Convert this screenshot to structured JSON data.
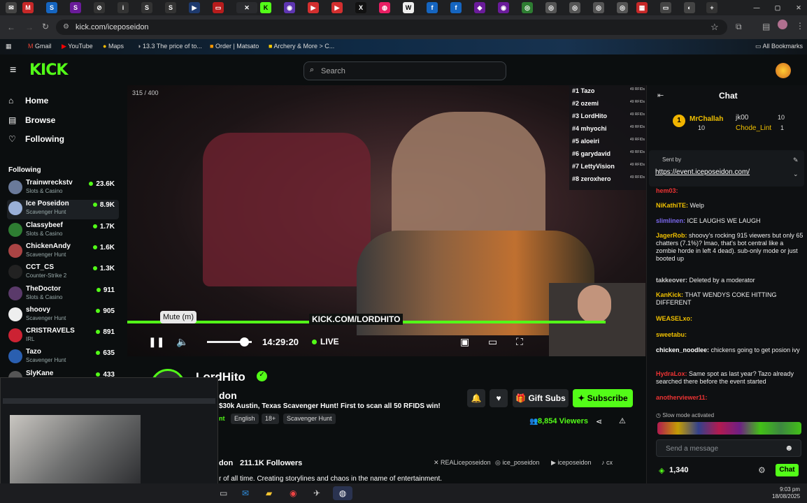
{
  "browser": {
    "url": "kick.com/iceposeidon",
    "bookmarks": [
      "Gmail",
      "YouTube",
      "Maps",
      "13.3 The price of to...",
      "Order | Matsato",
      "Archery & More > C...",
      "All Bookmarks"
    ]
  },
  "kick": {
    "logo": "KICK",
    "search_placeholder": "Search",
    "nav": [
      {
        "label": "Home"
      },
      {
        "label": "Browse"
      },
      {
        "label": "Following"
      }
    ],
    "following_header": "Following",
    "channels": [
      {
        "name": "Trainwreckstv",
        "category": "Slots & Casino",
        "viewers": "23.6K"
      },
      {
        "name": "Ice Poseidon",
        "category": "Scavenger Hunt",
        "viewers": "8.9K"
      },
      {
        "name": "Classybeef",
        "category": "Slots & Casino",
        "viewers": "1.7K"
      },
      {
        "name": "ChickenAndy",
        "category": "Scavenger Hunt",
        "viewers": "1.6K"
      },
      {
        "name": "CCT_CS",
        "category": "Counter-Strike 2",
        "viewers": "1.3K"
      },
      {
        "name": "TheDoctor",
        "category": "Slots & Casino",
        "viewers": "911"
      },
      {
        "name": "shoovy",
        "category": "Scavenger Hunt",
        "viewers": "905"
      },
      {
        "name": "CRISTRAVELS",
        "category": "IRL",
        "viewers": "891"
      },
      {
        "name": "Tazo",
        "category": "Scavenger Hunt",
        "viewers": "635"
      },
      {
        "name": "SlyKane",
        "category": "",
        "viewers": "433"
      }
    ]
  },
  "player": {
    "counter": "315 / 400",
    "leaderboard": [
      {
        "rank": "#1 Tazo",
        "pts": "49 RFIDs"
      },
      {
        "rank": "#2 ozemi",
        "pts": "49 RFIDs"
      },
      {
        "rank": "#3 LordHito",
        "pts": "49 RFIDs"
      },
      {
        "rank": "#4 mhyochi",
        "pts": "49 RFIDs"
      },
      {
        "rank": "#5 aloeiri",
        "pts": "49 RFIDs"
      },
      {
        "rank": "#6 garydavid",
        "pts": "49 RFIDs"
      },
      {
        "rank": "#7 LettyVision",
        "pts": "49 RFIDs"
      },
      {
        "rank": "#8 zerox​hero",
        "pts": "49 RFIDs"
      }
    ],
    "overlay_url": "KICK.COM/LORDHITO",
    "tooltip": "Mute (m)",
    "time": "14:29:20",
    "live": "LIVE",
    "volume_level": 0.85
  },
  "stream": {
    "channel_name": "LordHito",
    "title": "$30k Austin, Texas Scavenger Hunt! First to scan all 50 RFIDS win!",
    "tags": [
      "English",
      "18+",
      "Scavenger Hunt"
    ],
    "gift_subs": "Gift Subs",
    "subscribe": "Subscribe",
    "viewers": "8,854 Viewers",
    "followers": "211.1K Followers",
    "about": "r of all time. Creating storylines and chaos in the name of entertainment.",
    "socials": [
      "REALiceposeidon",
      "ice_poseidon",
      "iceposeidon",
      "cx"
    ],
    "partial_name": "don"
  },
  "chat": {
    "title": "Chat",
    "gifters": [
      {
        "name": "MrChallah",
        "count": "10"
      },
      {
        "name": "jk00",
        "count": "10"
      },
      {
        "name": "Chode_Lint",
        "count": "1"
      }
    ],
    "pinned_link": "https://event.iceposeidon.com/",
    "pinned_by": "Sent by",
    "messages": [
      {
        "user": "hem03:",
        "text": ""
      },
      {
        "user": "NiKathiTE:",
        "text": "Welp"
      },
      {
        "user": "slimlinen:",
        "text": "ICE LAUGHS WE LAUGH"
      },
      {
        "user": "JagerRob:",
        "text": "shoovy's rocking 915 viewers but only 65 chatters (7.1%)? lmao, that's bot central like a zombie horde in left 4 dead). sub-only mode or just booted up"
      },
      {
        "user": "takkeover:",
        "text": "Deleted by a moderator"
      },
      {
        "user": "KanKick:",
        "text": "THAT WENDYS COKE HITTING DIFFERENT"
      },
      {
        "user": "WEASELxo:",
        "text": ""
      },
      {
        "user": "sweetabu:",
        "text": ""
      },
      {
        "user": "chicken_noodlee:",
        "text": "chickens going to get posion ivy"
      },
      {
        "user": "HydraLox:",
        "text": "Same spot as last year? Tazo already searched there before the event started"
      },
      {
        "user": "anotherviewer11:",
        "text": ""
      }
    ],
    "slow_mode": "Slow mode activated",
    "input_placeholder": "Send a message",
    "points": "1,340",
    "send": "Chat"
  },
  "clock": {
    "time": "9:03 pm",
    "date": "18/08/2025"
  },
  "colors": {
    "accent": "#53fc18",
    "bg": "#0b0e0f"
  }
}
